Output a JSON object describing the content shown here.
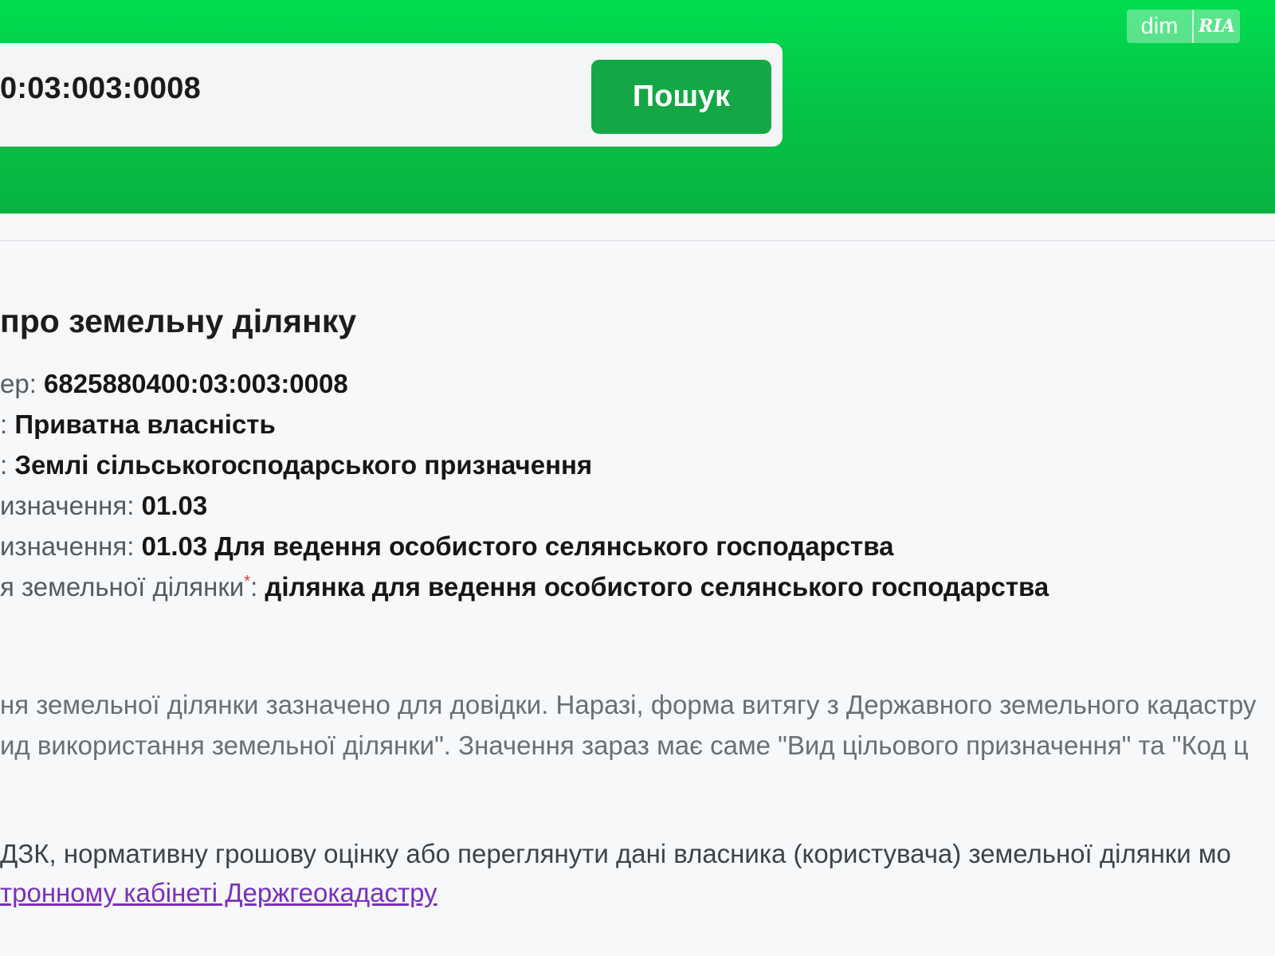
{
  "header": {
    "search_value": "0:03:003:0008",
    "search_button": "Пошук",
    "logo_dim": "dim",
    "logo_ria": "RIA"
  },
  "main": {
    "title": "про земельну ділянку",
    "rows": [
      {
        "label": "ер: ",
        "value": "6825880400:03:003:0008"
      },
      {
        "label": ": ",
        "value": "Приватна власність"
      },
      {
        "label": ": ",
        "value": "Землі сільськогосподарського призначення"
      },
      {
        "label": "изначення: ",
        "value": "01.03"
      },
      {
        "label": "изначення: ",
        "value": "01.03 Для ведення особистого селянського господарства"
      },
      {
        "label": "я земельної ділянки",
        "marker": "*",
        "sep": ": ",
        "value": "ділянка для ведення особистого селянського господарства"
      }
    ],
    "note_lines": [
      "ня земельної ділянки зазначено для довідки. Наразі, форма витягу з Державного земельного кадастру",
      "ид використання земельної ділянки\". Значення зараз має саме \"Вид цільового призначення\" та \"Код ц"
    ],
    "info_line": "ДЗК, нормативну грошову оцінку або переглянути дані власника (користувача) земельної ділянки мо",
    "link_text": "тронному кабінеті Держгеокадастру"
  },
  "colors": {
    "header_green": "#06c147",
    "button_green": "#14a745",
    "link_purple": "#7b2fc0",
    "required_red": "#d9362b"
  }
}
